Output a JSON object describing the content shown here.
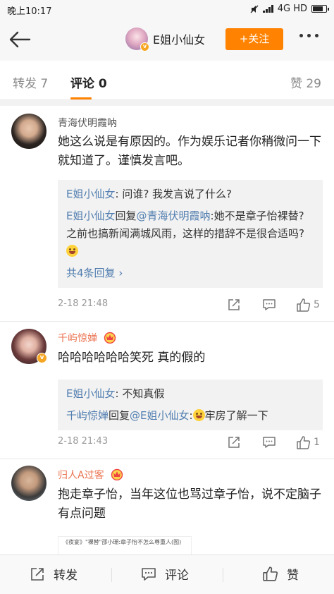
{
  "status_bar": {
    "time": "晚上10:17",
    "network": "4G HD"
  },
  "nav": {
    "user_name": "E姐小仙女",
    "follow_label": "+关注"
  },
  "tabs": {
    "repost": "转发 7",
    "comment": "评论 0",
    "like": "赞 29"
  },
  "colors": {
    "accent": "#ff8200",
    "link": "#507daf",
    "name_orange": "#eb7350"
  },
  "comments": [
    {
      "name": "青海伏明霞呐",
      "text": "她这么说是有原因的。作为娱乐记者你稍微问一下就知道了。谨慎发言吧。",
      "replies": [
        {
          "author": "E姐小仙女",
          "sep": ": ",
          "text": "问谁? 我发言说了什么?"
        },
        {
          "author": "E姐小仙女",
          "mid": "回复",
          "target": "@青海伏明霞呐",
          "sep": ":",
          "text": "她不是章子怡裸替? 之前也搞新闻满城风雨，这样的措辞不是很合适吗?"
        }
      ],
      "more": "共4条回复",
      "time": "2-18 21:48",
      "likes": "5"
    },
    {
      "name": "千屿惊婵",
      "text": "哈哈哈哈哈哈笑死  真的假的",
      "replies": [
        {
          "author": "E姐小仙女",
          "sep": ": ",
          "text": "不知真假"
        },
        {
          "author": "千屿惊婵",
          "mid": "回复",
          "target": "@E姐小仙女",
          "sep": ":",
          "text": "牢房了解一下"
        }
      ],
      "time": "2-18 21:43",
      "likes": "1"
    },
    {
      "name": "归人A过客",
      "text": "抱走章子怡，当年这位也骂过章子怡，说不定脑子有点问题",
      "image_text": "《夜宴》\"裸替\"邵小珊:章子怡不怎么尊重人(图)"
    }
  ],
  "bottom_bar": {
    "repost": "转发",
    "comment": "评论",
    "like": "赞"
  }
}
